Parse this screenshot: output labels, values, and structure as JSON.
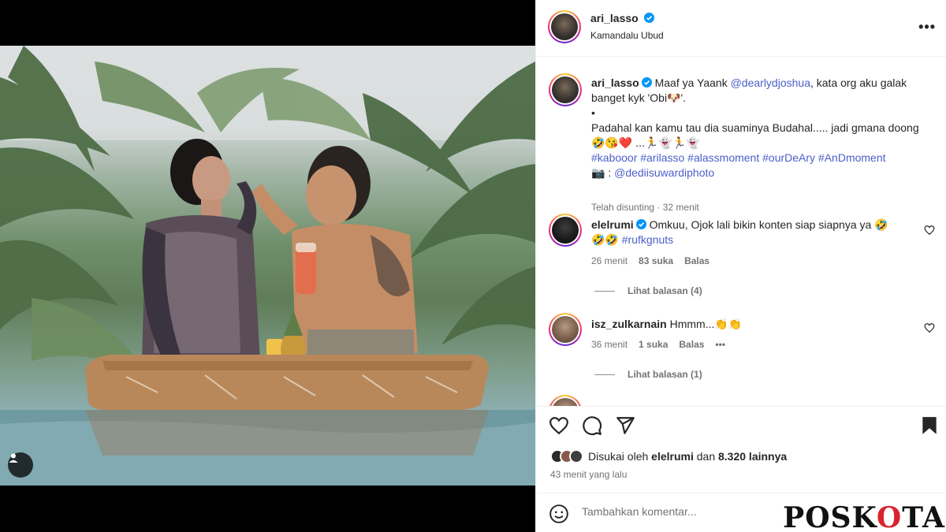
{
  "post": {
    "username": "ari_lasso",
    "location": "Kamandalu Ubud"
  },
  "caption": {
    "username": "ari_lasso",
    "line1_pre": "Maaf ya Yaank ",
    "mention": "@dearlydjoshua",
    "line1_post": ", kata org aku galak",
    "line2": "banget kyk 'Obi🐶'.",
    "bullet": "•",
    "line3": "Padahal kan kamu tau dia suaminya Budahal..... jadi gmana doong",
    "line4": "🤣😘❤️ ...🏃👻🏃👻",
    "hashtags": "#kabooor #arilasso #alassmoment #ourDeAry #AnDmoment",
    "camera": "📷 : ",
    "credit": "@dediisuwardiphoto",
    "edited": "Telah disunting · 32 menit"
  },
  "comments": [
    {
      "username": "elelrumi",
      "text": "Omkuu, Ojok lali bikin konten siap siapnya ya 🤣",
      "text2_emoji": "🤣🤣 ",
      "text2_tag": "#rufkgnuts",
      "time": "26 menit",
      "likes": "83 suka",
      "reply": "Balas",
      "view_replies": "Lihat balasan (4)"
    },
    {
      "username": "isz_zulkarnain",
      "text": "Hmmm...👏👏",
      "time": "36 menit",
      "likes": "1 suka",
      "reply": "Balas",
      "more": "•••",
      "view_replies": "Lihat balasan (1)"
    }
  ],
  "likes": {
    "prefix": "Disukai oleh ",
    "user": "elelrumi",
    "middle": " dan ",
    "count": "8.320 lainnya",
    "time_ago": "43 menit yang lalu"
  },
  "add_comment": {
    "placeholder": "Tambahkan komentar..."
  },
  "watermark": {
    "pre": "POSK",
    "mid": "O",
    "post": "TA"
  },
  "icons": [
    "verified-badge-icon",
    "more-options-icon",
    "heart-icon",
    "comment-icon",
    "share-icon",
    "bookmark-icon",
    "emoji-icon",
    "user-tag-icon"
  ],
  "colors": {
    "link": "#4b5fc9",
    "verified": "#0095f6",
    "watermark_accent": "#d9232e"
  }
}
